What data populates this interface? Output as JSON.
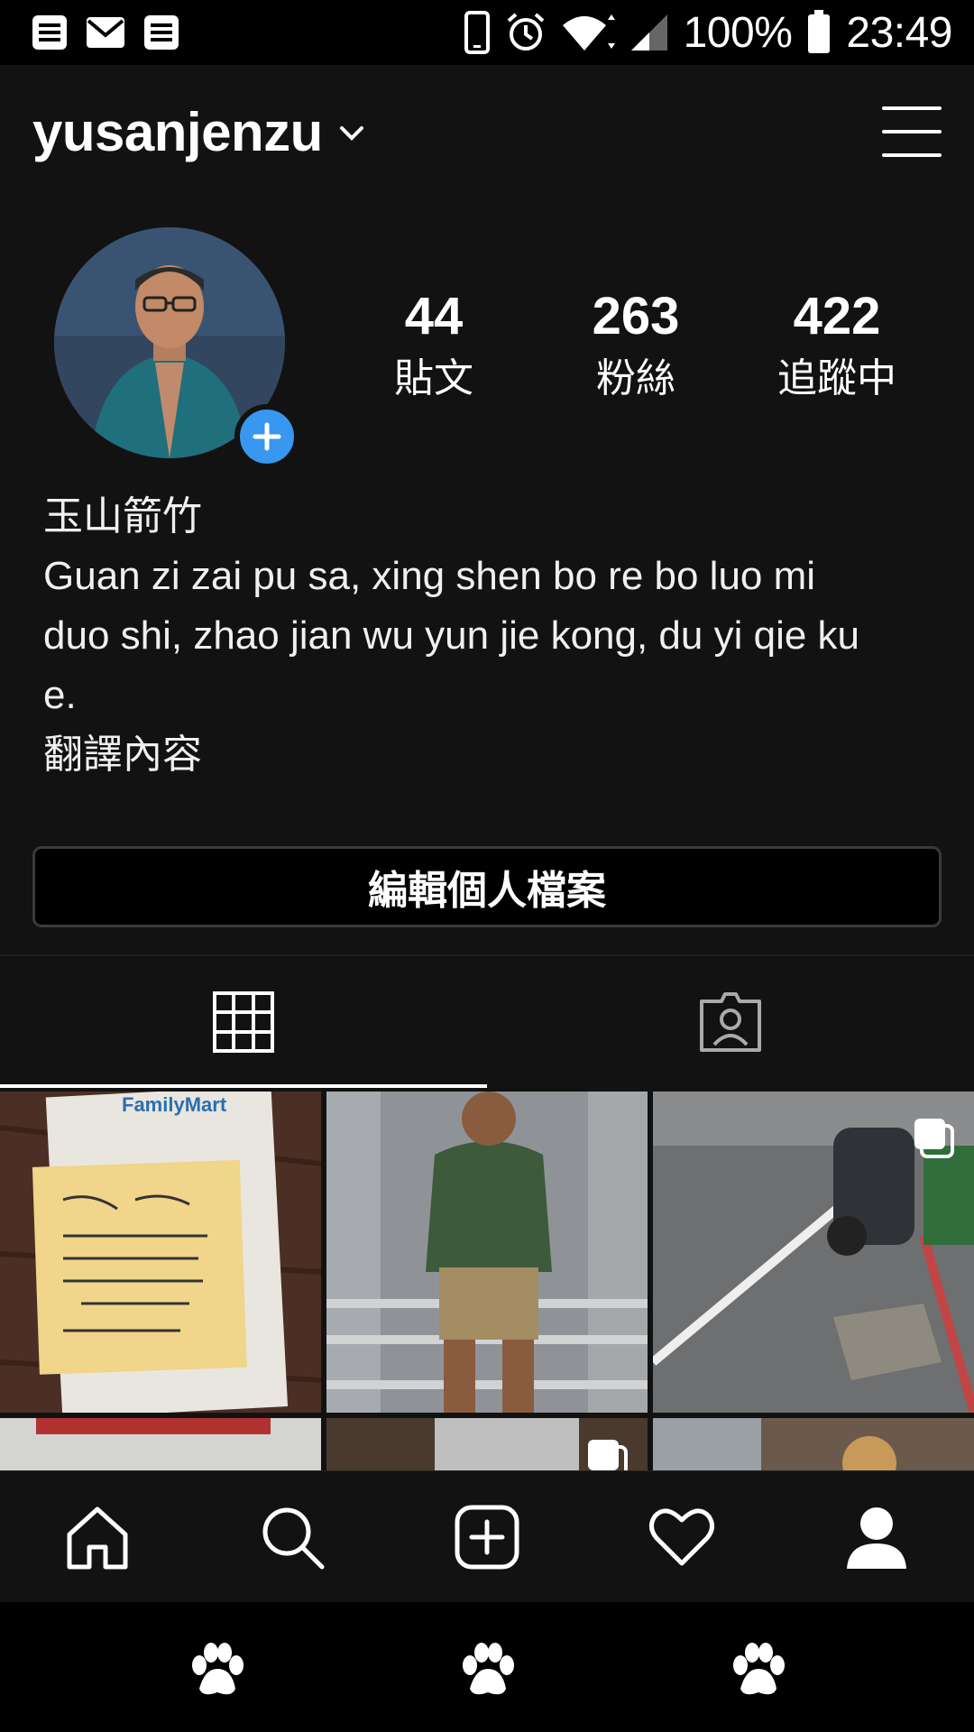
{
  "status_bar": {
    "battery": "100%",
    "time": "23:49",
    "left_icons": [
      "notes-icon",
      "mail-icon",
      "notes-icon"
    ],
    "right_icons": [
      "phone-icon",
      "alarm-icon",
      "wifi-icon",
      "signal-icon",
      "battery-icon"
    ]
  },
  "header": {
    "username": "yusanjenzu"
  },
  "profile": {
    "stats": [
      {
        "count": "44",
        "label": "貼文"
      },
      {
        "count": "263",
        "label": "粉絲"
      },
      {
        "count": "422",
        "label": "追蹤中"
      }
    ],
    "bio": {
      "name": "玉山箭竹",
      "line1": "Guan zi zai pu sa, xing shen bo re bo luo mi",
      "line2": "duo shi, zhao jian wu yun jie kong, du yi qie ku",
      "line3": "e.",
      "translate": "翻譯內容"
    },
    "edit_button": "編輯個人檔案"
  },
  "tabs": [
    {
      "icon": "grid-icon",
      "active": true
    },
    {
      "icon": "tagged-icon",
      "active": false
    }
  ],
  "grid_posts": [
    {
      "lettering": "FamilyMart"
    },
    {
      "lettering": ""
    },
    {
      "lettering": ""
    }
  ],
  "bottom_nav": [
    "home-icon",
    "search-icon",
    "add-post-icon",
    "heart-icon",
    "profile-icon"
  ],
  "colors": {
    "background": "#121212",
    "accent": "#3897f0",
    "text": "#ffffff"
  }
}
